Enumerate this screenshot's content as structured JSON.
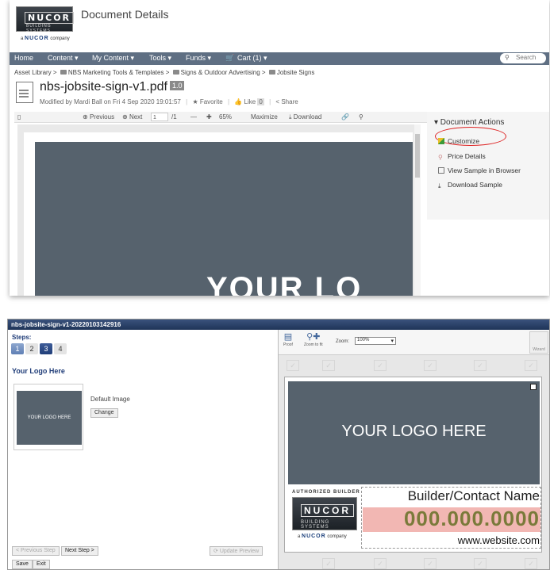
{
  "header": {
    "title": "Document Details",
    "logo_brand": "NUCOR",
    "logo_division": "BUILDING SYSTEMS",
    "logo_prefix": "a",
    "logo_company": "NUCOR",
    "logo_suffix": "company"
  },
  "nav": {
    "items": [
      "Home",
      "Content ▾",
      "My Content ▾",
      "Tools ▾",
      "Funds ▾",
      "Cart (1) ▾"
    ],
    "search_placeholder": "Search"
  },
  "breadcrumb": {
    "items": [
      "Asset Library",
      "NBS Marketing Tools & Templates",
      "Signs & Outdoor Advertising",
      "Jobsite Signs"
    ],
    "separator": ">"
  },
  "document": {
    "filename": "nbs-jobsite-sign-v1.pdf",
    "version": "1.0",
    "modified": "Modified by Mardi Ball on Fri 4 Sep 2020 19:01:57",
    "favorite": "Favorite",
    "like": "Like",
    "like_count": "0",
    "share": "Share"
  },
  "toolbar": {
    "previous": "Previous",
    "next": "Next",
    "page_value": "1",
    "page_total": "/1",
    "zoom": "65%",
    "maximize": "Maximize",
    "download": "Download"
  },
  "preview": {
    "text": "YOUR LO"
  },
  "actions": {
    "title": "▾ Document Actions",
    "items": [
      "Customize",
      "Price Details",
      "View Sample in Browser",
      "Download Sample"
    ]
  },
  "editor": {
    "window_title": "nbs-jobsite-sign-v1-20220103142916",
    "steps_label": "Steps:",
    "steps": [
      "1",
      "2",
      "3",
      "4"
    ],
    "section_title": "Your Logo Here",
    "thumb_text": "YOUR LOGO HERE",
    "default_image": "Default Image",
    "change": "Change",
    "prev_step": "< Previous Step",
    "next_step": "Next Step >",
    "update_preview": "Update Preview",
    "save": "Save",
    "exit": "Exit",
    "tools": {
      "proof": "Proof",
      "zoom_fit": "Zoom to fit",
      "zoom_label": "Zoom:",
      "zoom_value": "100%",
      "wizard": "Wizard"
    }
  },
  "sign": {
    "logo_text": "YOUR LOGO HERE",
    "authorized": "AUTHORIZED BUILDER",
    "builder": "Builder/Contact Name",
    "phone": "000.000.0000",
    "website": "www.website.com"
  }
}
